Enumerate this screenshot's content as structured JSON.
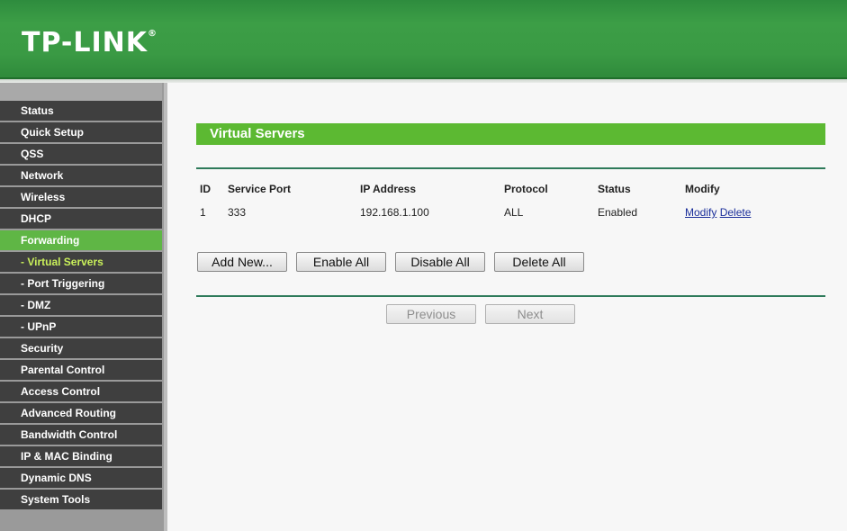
{
  "header": {
    "logo": "TP-LINK",
    "logo_mark": "®"
  },
  "sidebar": {
    "items": [
      {
        "label": "Status"
      },
      {
        "label": "Quick Setup"
      },
      {
        "label": "QSS"
      },
      {
        "label": "Network"
      },
      {
        "label": "Wireless"
      },
      {
        "label": "DHCP"
      },
      {
        "label": "Forwarding"
      },
      {
        "label": "- Virtual Servers"
      },
      {
        "label": "- Port Triggering"
      },
      {
        "label": "- DMZ"
      },
      {
        "label": "- UPnP"
      },
      {
        "label": "Security"
      },
      {
        "label": "Parental Control"
      },
      {
        "label": "Access Control"
      },
      {
        "label": "Advanced Routing"
      },
      {
        "label": "Bandwidth Control"
      },
      {
        "label": "IP & MAC Binding"
      },
      {
        "label": "Dynamic DNS"
      },
      {
        "label": "System Tools"
      }
    ]
  },
  "main": {
    "title": "Virtual Servers",
    "table": {
      "headers": [
        "ID",
        "Service Port",
        "IP Address",
        "Protocol",
        "Status",
        "Modify"
      ],
      "rows": [
        {
          "id": "1",
          "service_port": "333",
          "ip": "192.168.1.100",
          "protocol": "ALL",
          "status": "Enabled",
          "modify": "Modify",
          "delete": "Delete"
        }
      ]
    },
    "buttons": {
      "add_new": "Add New...",
      "enable_all": "Enable All",
      "disable_all": "Disable All",
      "delete_all": "Delete All"
    },
    "pagination": {
      "previous": "Previous",
      "next": "Next"
    }
  },
  "colors": {
    "header_green": "#3a9a44",
    "title_bar_green": "#5cb932",
    "menu_dark": "#3f3f3f",
    "menu_active": "#5fb645",
    "submenu_active_text": "#c9f05a",
    "link": "#1a2e9a"
  }
}
